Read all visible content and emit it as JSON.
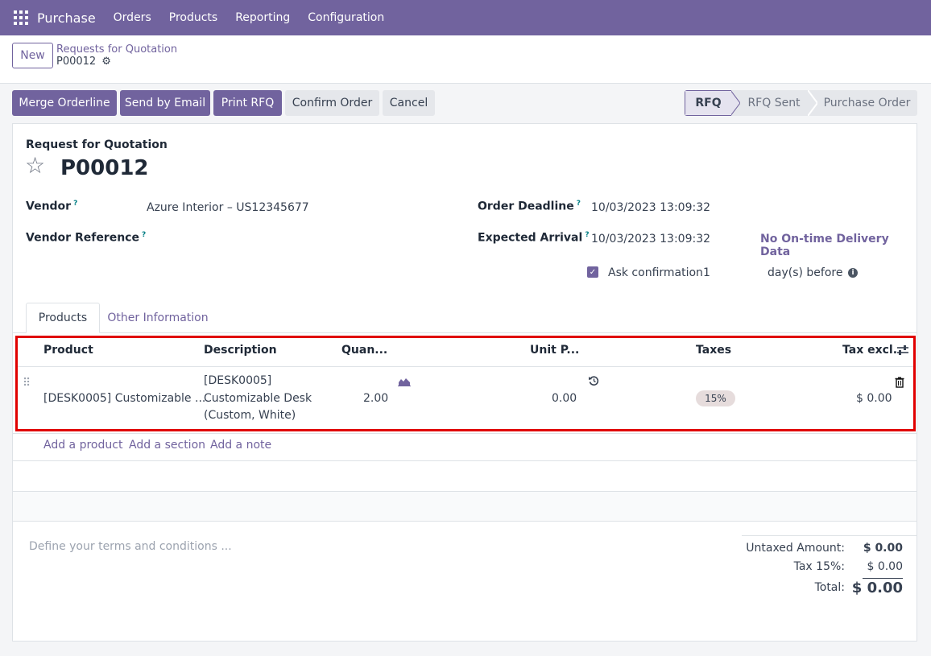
{
  "nav": {
    "brand": "Purchase",
    "items": [
      "Orders",
      "Products",
      "Reporting",
      "Configuration"
    ]
  },
  "control": {
    "new_label": "New",
    "breadcrumb_parent": "Requests for Quotation",
    "breadcrumb_current": "P00012"
  },
  "actions": {
    "merge": "Merge Orderline",
    "send_email": "Send by Email",
    "print": "Print RFQ",
    "confirm": "Confirm Order",
    "cancel": "Cancel"
  },
  "status": {
    "stages": [
      "RFQ",
      "RFQ Sent",
      "Purchase Order"
    ],
    "active": "RFQ"
  },
  "form": {
    "doc_type": "Request for Quotation",
    "reference": "P00012",
    "vendor_label": "Vendor",
    "vendor_value": "Azure Interior – US12345677",
    "vendor_ref_label": "Vendor Reference",
    "deadline_label": "Order Deadline",
    "deadline_value": "10/03/2023 13:09:32",
    "arrival_label": "Expected Arrival",
    "arrival_value": "10/03/2023 13:09:32",
    "on_time_link": "No On-time Delivery Data",
    "ask_confirmation_label": "Ask confirmation",
    "ask_confirmation_days": "1",
    "days_before": "day(s) before",
    "help_mark": "?"
  },
  "tabs": [
    "Products",
    "Other Information"
  ],
  "table": {
    "columns": [
      "Product",
      "Description",
      "Quan...",
      "Unit P...",
      "Taxes",
      "Tax excl."
    ],
    "row": {
      "product": "[DESK0005] Customizable ...",
      "description_1": "[DESK0005]",
      "description_2": "Customizable Desk",
      "description_3": "(Custom, White)",
      "quantity": "2.00",
      "unit_price": "0.00",
      "tax": "15%",
      "subtotal": "$ 0.00"
    },
    "add_product": "Add a product",
    "add_section": "Add a section",
    "add_note": "Add a note"
  },
  "footer": {
    "terms_placeholder": "Define your terms and conditions ...",
    "untaxed_label": "Untaxed Amount:",
    "untaxed_value": "$ 0.00",
    "tax_label": "Tax 15%:",
    "tax_value": "$ 0.00",
    "total_label": "Total:",
    "total_value": "$ 0.00"
  },
  "colors": {
    "brand": "#71639e",
    "highlight": "#e00000"
  }
}
